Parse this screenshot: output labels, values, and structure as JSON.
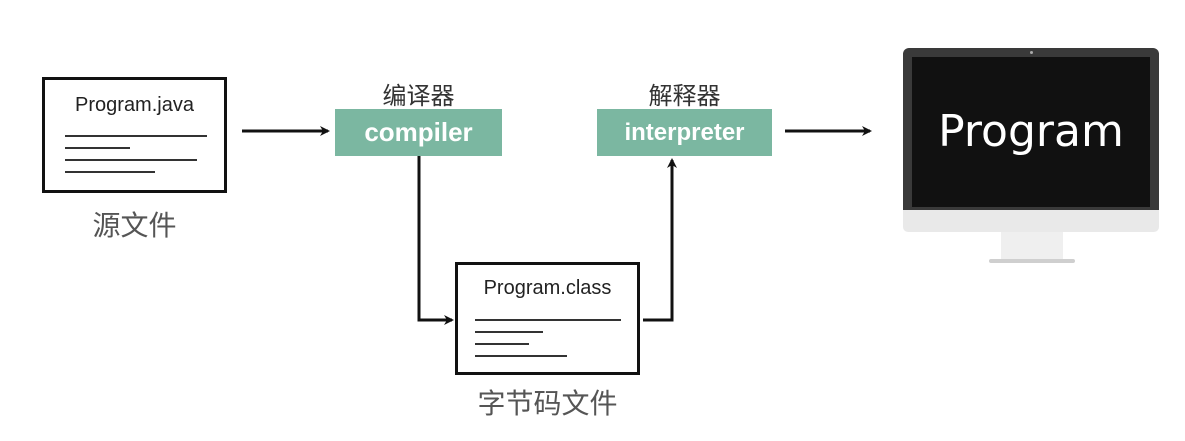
{
  "source_file": {
    "filename": "Program.java",
    "caption": "源文件"
  },
  "compiler": {
    "cn_label": "编译器",
    "en_label": "compiler"
  },
  "bytecode_file": {
    "filename": "Program.class",
    "caption": "字节码文件"
  },
  "interpreter": {
    "cn_label": "解释器",
    "en_label": "interpreter"
  },
  "monitor": {
    "screen_text": "Program"
  },
  "colors": {
    "badge": "#7bb7a1",
    "screen": "#111111",
    "frame": "#3a3a3a",
    "stand": "#e8e8e8"
  }
}
